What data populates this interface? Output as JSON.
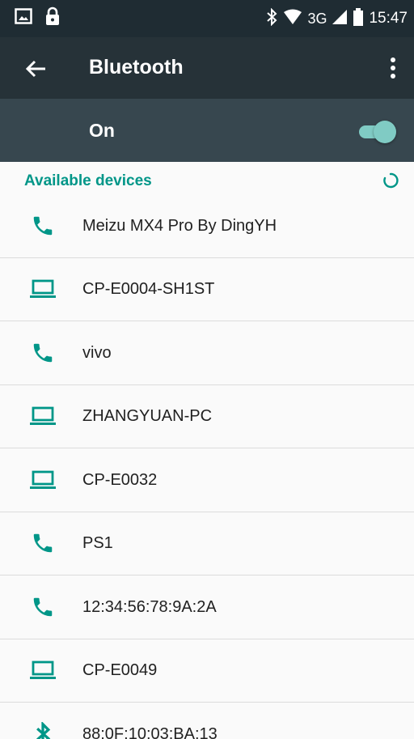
{
  "status_bar": {
    "time": "15:47",
    "network": "3G",
    "icons": [
      "image-icon",
      "lock-icon",
      "bluetooth-icon",
      "wifi-icon",
      "signal-icon",
      "battery-icon"
    ]
  },
  "app_bar": {
    "title": "Bluetooth",
    "back_icon": "arrow-back-icon",
    "menu_icon": "more-vert-icon"
  },
  "bluetooth_switch": {
    "label": "On",
    "state": "on"
  },
  "available_devices": {
    "header": "Available devices",
    "scanning": true,
    "devices": [
      {
        "name": "Meizu MX4 Pro By DingYH",
        "icon": "phone-icon"
      },
      {
        "name": "CP-E0004-SH1ST",
        "icon": "laptop-icon"
      },
      {
        "name": "vivo",
        "icon": "phone-icon"
      },
      {
        "name": "ZHANGYUAN-PC",
        "icon": "laptop-icon"
      },
      {
        "name": "CP-E0032",
        "icon": "laptop-icon"
      },
      {
        "name": "PS1",
        "icon": "phone-icon"
      },
      {
        "name": "12:34:56:78:9A:2A",
        "icon": "phone-icon"
      },
      {
        "name": "CP-E0049",
        "icon": "laptop-icon"
      },
      {
        "name": "88:0F:10:03:BA:13",
        "icon": "bluetooth-icon"
      }
    ]
  },
  "colors": {
    "status_bar": "#1f2c33",
    "app_bar": "#263238",
    "switch_bar": "#37474f",
    "accent": "#009688",
    "toggle": "#80cbc4",
    "background": "#fafafa"
  }
}
